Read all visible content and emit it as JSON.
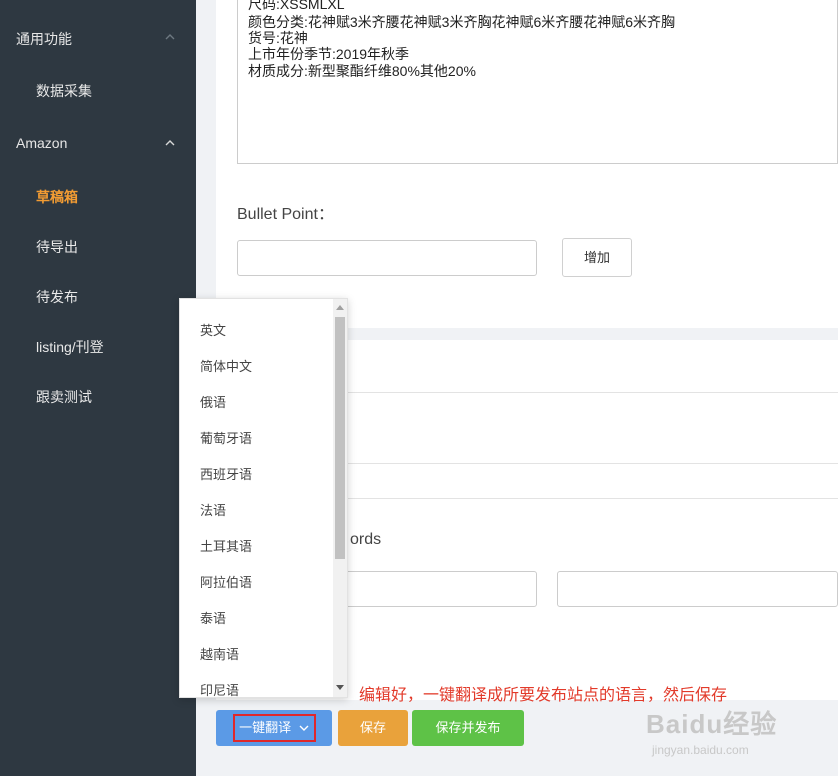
{
  "sidebar": {
    "groups": [
      {
        "label": "通用功能",
        "items": [
          "数据采集"
        ]
      },
      {
        "label": "Amazon",
        "items": [
          "草稿箱",
          "待导出",
          "待发布",
          "listing/刊登",
          "跟卖测试"
        ]
      }
    ],
    "active_item": "草稿箱",
    "accent_color": "#f29c33",
    "background_color": "#2e3841"
  },
  "description": {
    "lines": [
      "尺码:XSSMLXL",
      "颜色分类:花神赋3米齐腰花神赋3米齐胸花神赋6米齐腰花神赋6米齐胸",
      "货号:花神",
      "上市年份季节:2019年秋季",
      "材质成分:新型聚酯纤维80%其他20%"
    ]
  },
  "bullet_point": {
    "label": "Bullet Point：",
    "input_value": "",
    "add_button": "增加"
  },
  "keywords": {
    "label_visible_part": "ords"
  },
  "language_dropdown": {
    "options": [
      "英文",
      "简体中文",
      "俄语",
      "葡萄牙语",
      "西班牙语",
      "法语",
      "土耳其语",
      "阿拉伯语",
      "泰语",
      "越南语",
      "印尼语"
    ]
  },
  "annotation": "编辑好，一键翻译成所要发布站点的语言，然后保存",
  "actions": {
    "translate": "一键翻译",
    "save": "保存",
    "save_publish": "保存并发布"
  },
  "watermark": {
    "brand": "Baidu经验",
    "url": "jingyan.baidu.com"
  }
}
